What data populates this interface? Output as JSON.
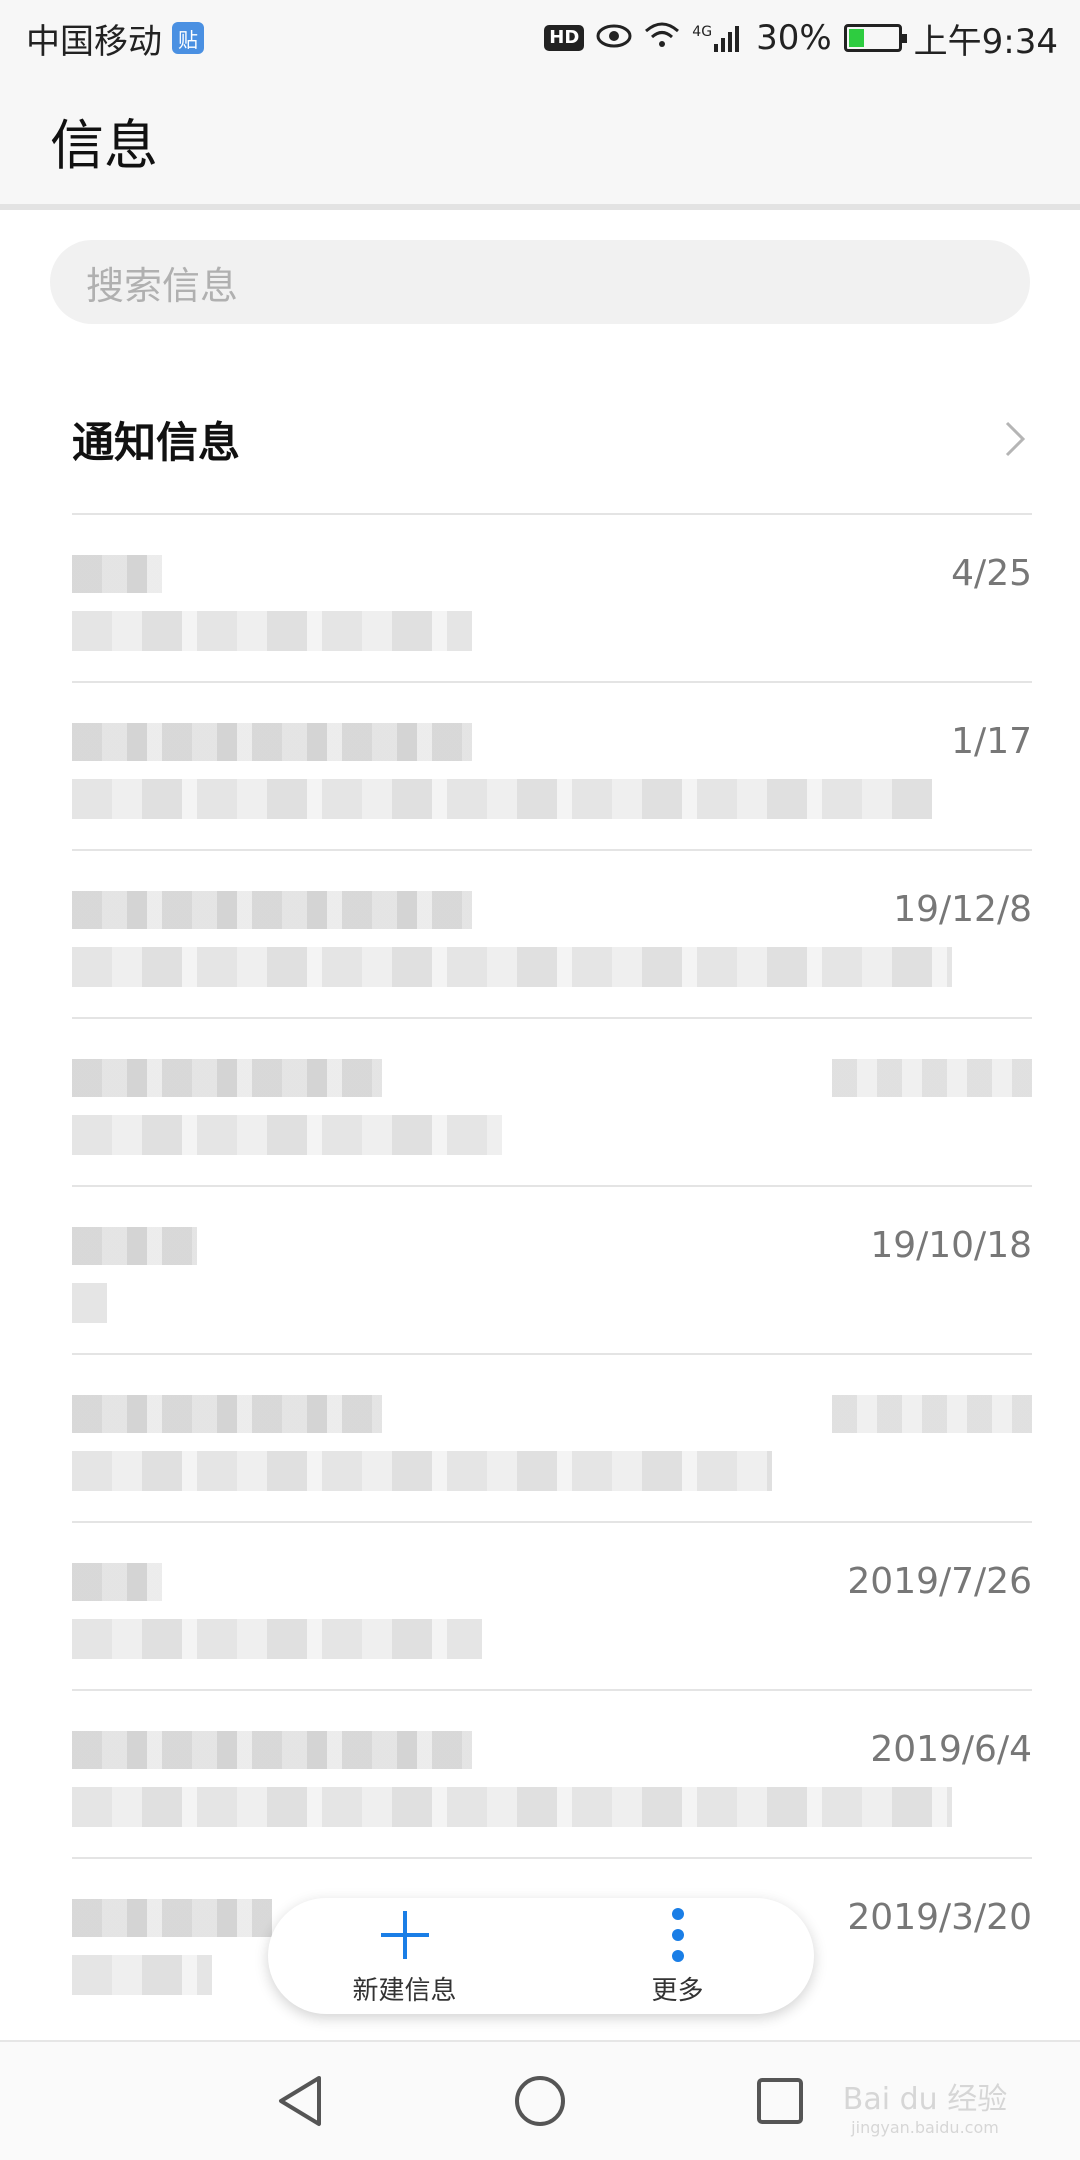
{
  "status_bar": {
    "carrier": "中国移动",
    "app_badge": "贴",
    "hd": "HD",
    "network": "4G",
    "battery_percent": "30%",
    "battery_level": 0.3,
    "time": "上午9:34"
  },
  "app_bar": {
    "title": "信息"
  },
  "search": {
    "placeholder": "搜索信息"
  },
  "notification": {
    "label": "通知信息"
  },
  "messages": [
    {
      "date": "4/25",
      "date_visible": true
    },
    {
      "date": "1/17",
      "date_visible": true
    },
    {
      "date": "19/12/8",
      "date_visible": true
    },
    {
      "date": "",
      "date_visible": false
    },
    {
      "date": "19/10/18",
      "date_visible": true
    },
    {
      "date": "",
      "date_visible": false
    },
    {
      "date": "2019/7/26",
      "date_visible": true
    },
    {
      "date": "2019/6/4",
      "date_visible": true
    },
    {
      "date": "2019/3/20",
      "date_visible": true
    }
  ],
  "actions": {
    "new_message": "新建信息",
    "more": "更多"
  },
  "colors": {
    "accent": "#1a7ee6",
    "battery_green": "#2ecc40"
  },
  "watermark": {
    "brand": "Bai du 经验",
    "url": "jingyan.baidu.com"
  }
}
